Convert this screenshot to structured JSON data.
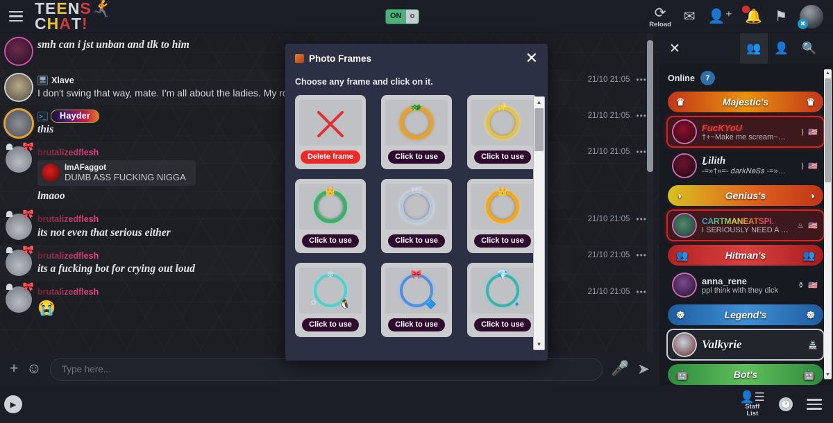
{
  "header": {
    "logo_line1": [
      {
        "t": "TE",
        "c": "#cfd2d8"
      },
      {
        "t": "E",
        "c": "#e8c23a"
      },
      {
        "t": "N",
        "c": "#d8dae0"
      },
      {
        "t": "S",
        "c": "#d13a3a"
      }
    ],
    "logo_line2": [
      {
        "t": "C",
        "c": "#cfd2d8"
      },
      {
        "t": "H",
        "c": "#e8c23a"
      },
      {
        "t": "A",
        "c": "#d13a3a"
      },
      {
        "t": "T",
        "c": "#cfd2d8"
      },
      {
        "t": "!",
        "c": "#d13a3a"
      }
    ],
    "toggle": {
      "on_label": "ON",
      "knob_label": "o"
    },
    "reload_label": "Reload",
    "icons": [
      "reload-icon",
      "mail-icon",
      "add-friend-icon",
      "notification-bell-icon",
      "flag-icon"
    ],
    "avatar_badge": "✖"
  },
  "chat": {
    "messages": [
      {
        "name": "",
        "text": "smh can i jst unban and tlk to him",
        "style": "italic",
        "avatar": "purple",
        "badge": "",
        "timestamp": ""
      },
      {
        "name": "Xlave",
        "text": "I don't swing that way, mate. I'm all about the ladies. My robo bab",
        "style": "plain",
        "avatar": "sepia",
        "badge": "mac",
        "timestamp": "21/10 21:05"
      },
      {
        "name": "Hayder",
        "text": "this",
        "style": "italic",
        "avatar": "gold",
        "badge": "terminal",
        "timestamp": "21/10 21:05"
      },
      {
        "name": "brutalizedflesh",
        "text": "lmaoo",
        "style": "italic",
        "avatar": "hk",
        "badge": "",
        "timestamp": "21/10 21:05",
        "quote": {
          "name": "ImAFaggot",
          "text": "DUMB ASS FUCKING NIGGA"
        }
      },
      {
        "name": "brutalizedflesh",
        "text": "its not even that serious either",
        "style": "italic",
        "avatar": "hk",
        "badge": "",
        "timestamp": "21/10 21:05"
      },
      {
        "name": "brutalizedflesh",
        "text": "its a fucking bot for crying out loud",
        "style": "italic",
        "avatar": "hk",
        "badge": "",
        "timestamp": "21/10 21:05"
      },
      {
        "name": "brutalizedflesh",
        "text": "😭",
        "style": "emoji",
        "avatar": "hk",
        "badge": "",
        "timestamp": "21/10 21:05"
      }
    ],
    "menu_dots": "•••"
  },
  "modal": {
    "title": "Photo Frames",
    "close_label": "✕",
    "instruction": "Choose any frame and click on it.",
    "frames": [
      {
        "label": "Delete frame",
        "kind": "delete",
        "ring": ""
      },
      {
        "label": "Click to use",
        "kind": "frame",
        "ring": "dragon"
      },
      {
        "label": "Click to use",
        "kind": "frame",
        "ring": "star"
      },
      {
        "label": "Click to use",
        "kind": "frame",
        "ring": "green"
      },
      {
        "label": "Click to use",
        "kind": "frame",
        "ring": "wing"
      },
      {
        "label": "Click to use",
        "kind": "frame",
        "ring": "gold"
      },
      {
        "label": "Click to use",
        "kind": "frame",
        "ring": "teal1"
      },
      {
        "label": "Click to use",
        "kind": "frame",
        "ring": "blue1"
      },
      {
        "label": "Click to use",
        "kind": "frame",
        "ring": "teal2"
      }
    ]
  },
  "sidebar": {
    "close_label": "✕",
    "tabs": [
      "group-icon",
      "person-icon",
      "search-icon"
    ],
    "online_label": "Online",
    "online_count": "7",
    "entries": [
      {
        "type": "banner",
        "label": "Majestic's",
        "theme": "majestic",
        "icon": "♛"
      },
      {
        "type": "user",
        "name": "FucKYoU",
        "status": "†+~Make me scream~…",
        "nameStyle": "red",
        "avatar": "r1",
        "highlight": true,
        "flag": "🇺🇸",
        "mark": "⟩"
      },
      {
        "type": "user",
        "name": "Ḻilith",
        "status": "-=»†«=- 𝑑𝑎𝑟𝑘𝑁𝑒𝑆𝑠 -=»…",
        "nameStyle": "wht",
        "avatar": "r2",
        "highlight": false,
        "flag": "🇺🇸",
        "mark": "⟩"
      },
      {
        "type": "banner",
        "label": "Genius's",
        "theme": "genius",
        "icon": "◑"
      },
      {
        "type": "user",
        "name": "CARTMANEATSPI.",
        "status": "I SERIOUSLY NEED A …",
        "nameStyle": "rain",
        "avatar": "r3",
        "highlight": true,
        "flag": "🇺🇸",
        "mark": "♨"
      },
      {
        "type": "banner",
        "label": "Hitman's",
        "theme": "hitman",
        "icon": "👥"
      },
      {
        "type": "user",
        "name": "anna_rene",
        "status": "ppl think with they dick",
        "nameStyle": "plainw",
        "avatar": "r4",
        "highlight": false,
        "flag": "🇺🇸",
        "mark": "⚱"
      },
      {
        "type": "banner",
        "label": "Legend's",
        "theme": "legend",
        "icon": "☸"
      },
      {
        "type": "user",
        "name": "Valkyrie",
        "status": "",
        "nameStyle": "valkn",
        "avatar": "r5",
        "highlight": false,
        "valk": true,
        "flag": "",
        "mark": "🏯"
      },
      {
        "type": "banner",
        "label": "Bot's",
        "theme": "bots",
        "icon": "🤖"
      }
    ]
  },
  "input": {
    "placeholder": "Type here...",
    "plus_icon": "+",
    "emoji_icon": "☺",
    "mic_icon": "🎤",
    "send_icon": "➤"
  },
  "footer": {
    "play_icon": "▶",
    "staff_line1": "Staff",
    "staff_line2": "List",
    "clock_icon": "🕐"
  }
}
